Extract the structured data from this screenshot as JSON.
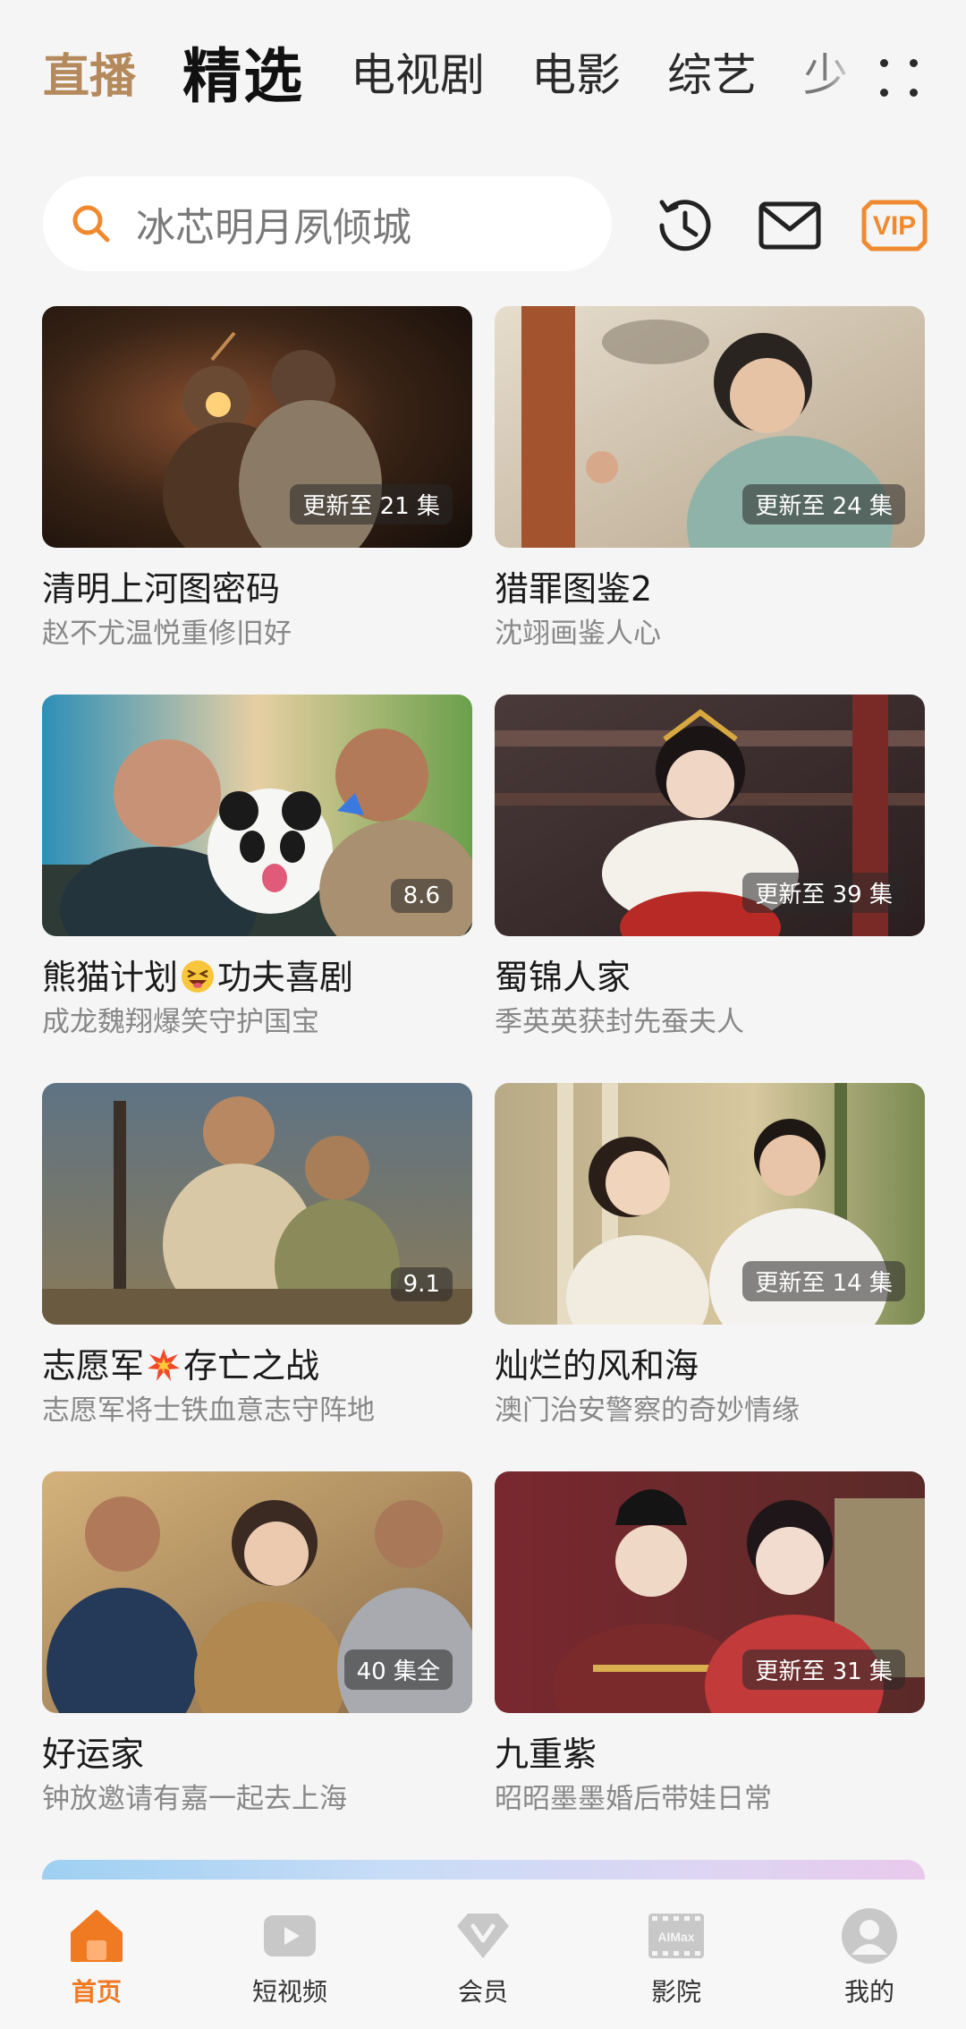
{
  "colors": {
    "accent_orange": "#f07a22",
    "live_gold": "#b48a5c",
    "vip_orange": "#f08a30"
  },
  "top_tabs": [
    {
      "label": "直播",
      "state": "live"
    },
    {
      "label": "精选",
      "state": "active"
    },
    {
      "label": "电视剧",
      "state": "normal"
    },
    {
      "label": "电影",
      "state": "normal"
    },
    {
      "label": "综艺",
      "state": "normal"
    },
    {
      "label": "少",
      "state": "partial"
    }
  ],
  "more_icon": "grid-dots-icon",
  "search": {
    "placeholder": "冰芯明月夙倾城",
    "icon": "search-icon"
  },
  "header_icons": [
    {
      "name": "history-icon"
    },
    {
      "name": "mail-icon"
    },
    {
      "name": "vip-icon",
      "label": "VIP"
    }
  ],
  "cards": [
    {
      "title": "清明上河图密码",
      "subtitle": "赵不尤温悦重修旧好",
      "badge": "更新至 21 集",
      "thumb_colors": [
        "#1f140e",
        "#6a3b20",
        "#3a2a20"
      ]
    },
    {
      "title": "猎罪图鉴2",
      "subtitle": "沈翊画鉴人心",
      "badge": "更新至 24 集",
      "thumb_colors": [
        "#d9cfc0",
        "#9ab3a8",
        "#6b5540"
      ]
    },
    {
      "title_before": "熊猫计划",
      "title_emoji": "grinning-squint-emoji",
      "title_after": "功夫喜剧",
      "subtitle": "成龙魏翔爆笑守护国宝",
      "badge": "8.6",
      "thumb_colors": [
        "#3aa0c8",
        "#e6d2a8",
        "#4a6a3a"
      ]
    },
    {
      "title": "蜀锦人家",
      "subtitle": "季英英获封先蚕夫人",
      "badge": "更新至 39 集",
      "thumb_colors": [
        "#3a2a2a",
        "#b3302a",
        "#f2ece6"
      ]
    },
    {
      "title_before": "志愿军",
      "title_emoji": "collision-emoji",
      "title_after": "存亡之战",
      "subtitle": "志愿军将士铁血意志守阵地",
      "badge": "9.1",
      "thumb_colors": [
        "#6a8090",
        "#c9ad80",
        "#6a6040"
      ]
    },
    {
      "title": "灿烂的风和海",
      "subtitle": "澳门治安警察的奇妙情缘",
      "badge": "更新至 14 集",
      "thumb_colors": [
        "#c9b994",
        "#f0e6d0",
        "#8a9a60"
      ]
    },
    {
      "title": "好运家",
      "subtitle": "钟放邀请有嘉一起去上海",
      "badge": "40 集全",
      "thumb_colors": [
        "#c7a36a",
        "#f0d9a8",
        "#4a5a70"
      ]
    },
    {
      "title": "九重紫",
      "subtitle": "昭昭墨墨婚后带娃日常",
      "badge": "更新至 31 集",
      "thumb_colors": [
        "#7a2028",
        "#c24040",
        "#e8c8b0"
      ]
    }
  ],
  "bottom_nav": [
    {
      "label": "首页",
      "icon": "home-icon",
      "active": true
    },
    {
      "label": "短视频",
      "icon": "play-icon",
      "active": false
    },
    {
      "label": "会员",
      "icon": "diamond-icon",
      "active": false
    },
    {
      "label": "影院",
      "icon": "imax-icon",
      "icon_text": "AIMax",
      "active": false
    },
    {
      "label": "我的",
      "icon": "avatar-icon",
      "active": false
    }
  ]
}
